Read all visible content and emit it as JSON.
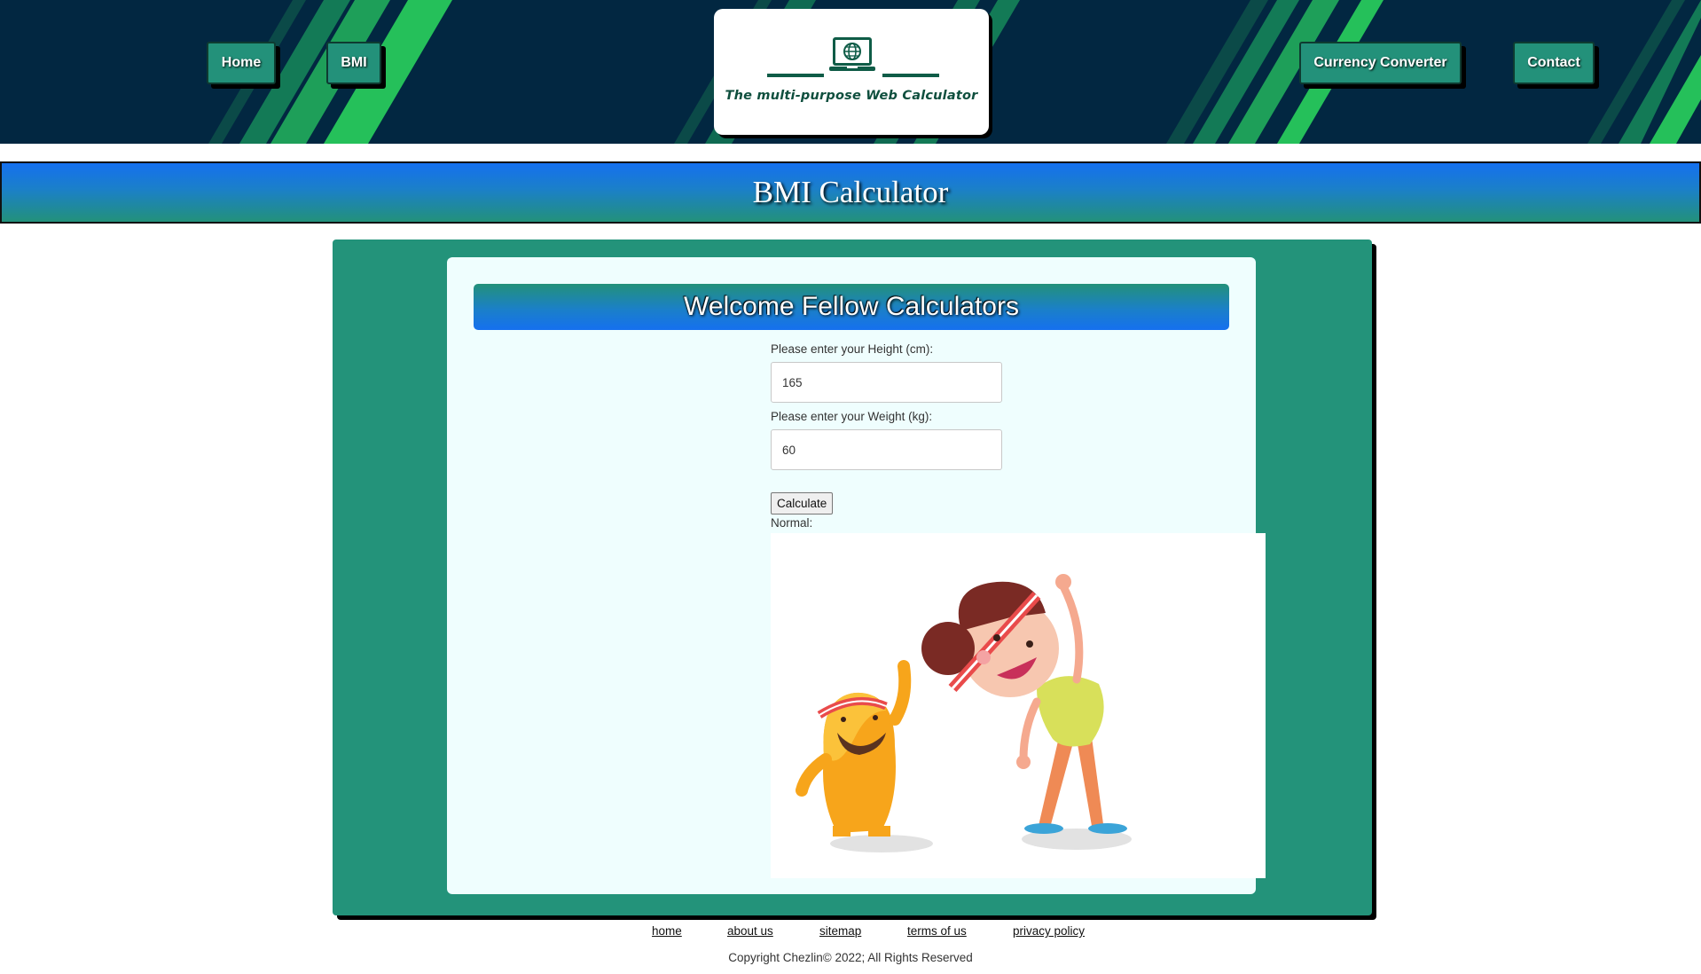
{
  "nav": {
    "home": "Home",
    "bmi": "BMI",
    "currency": "Currency Converter",
    "contact": "Contact"
  },
  "logo": {
    "text": "The multi-purpose Web Calculator",
    "icon": "laptop-globe-icon"
  },
  "page_title": "BMI Calculator",
  "form": {
    "welcome": "Welcome Fellow Calculators",
    "height_label": "Please enter your Height (cm):",
    "height_value": "165",
    "weight_label": "Please enter your Weight (kg):",
    "weight_value": "60",
    "calculate_label": "Calculate",
    "result_label": "Normal:"
  },
  "footer": {
    "links": [
      "home",
      "about us",
      "sitemap",
      "terms of us",
      "privacy policy"
    ],
    "copyright": "Copyright Chezlin© 2022; All Rights Reserved"
  },
  "colors": {
    "header_bg": "#022741",
    "accent_green": "#23917a",
    "accent_blue": "#1570ef",
    "stripe_green": "#25c05a"
  }
}
